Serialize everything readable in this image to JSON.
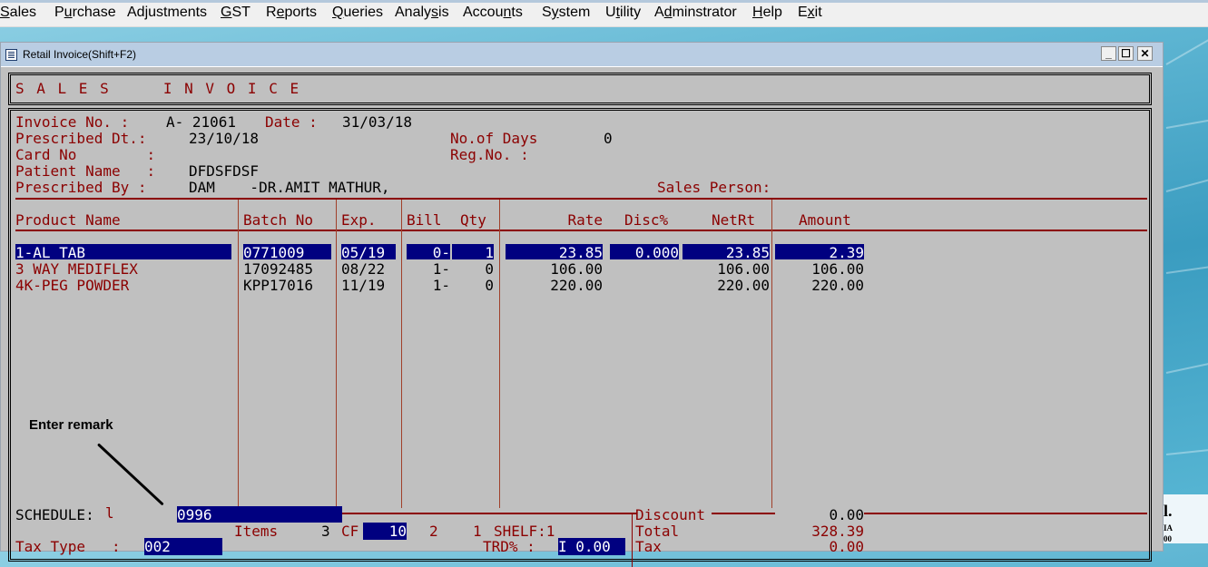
{
  "menubar": {
    "items": [
      {
        "label": "Sales",
        "mnemonic": "S"
      },
      {
        "label": "Purchase",
        "mnemonic": "u"
      },
      {
        "label": "Adjustments",
        "mnemonic": "j"
      },
      {
        "label": "GST",
        "mnemonic": "G"
      },
      {
        "label": "Reports",
        "mnemonic": "e"
      },
      {
        "label": "Queries",
        "mnemonic": "Q"
      },
      {
        "label": "Analysis",
        "mnemonic": "s"
      },
      {
        "label": "Accounts",
        "mnemonic": "n"
      },
      {
        "label": "System",
        "mnemonic": "y"
      },
      {
        "label": "Utility",
        "mnemonic": "t"
      },
      {
        "label": "Adminstrator",
        "mnemonic": "d"
      },
      {
        "label": "Help",
        "mnemonic": "H"
      },
      {
        "label": "Exit",
        "mnemonic": "x"
      }
    ]
  },
  "window": {
    "title": "Retail Invoice(Shift+F2)",
    "icon": "window-menu-icon",
    "controls": {
      "minimize": "_",
      "maximize": "☐",
      "close": "✕"
    }
  },
  "invoice": {
    "heading": "S A L E S     I N V O I C E",
    "invoice_no_label": "Invoice No. :",
    "invoice_no": "A- 21061",
    "date_label": "Date :",
    "date": "31/03/18",
    "prescribed_dt_label": "Prescribed Dt.:",
    "prescribed_dt": "23/10/18",
    "no_of_days_label": "No.of Days",
    "no_of_days": "0",
    "card_no_label": "Card No        :",
    "card_no": "",
    "reg_no_label": "Reg.No. :",
    "reg_no": "",
    "patient_name_label": "Patient Name   :",
    "patient_name": "DFDSFDSF",
    "prescribed_by_label": "Prescribed By :",
    "prescribed_by": "DAM    -DR.AMIT MATHUR,",
    "sales_person_label": "Sales Person:",
    "sales_person": ""
  },
  "table": {
    "columns": [
      "Product Name",
      "Batch No",
      "Exp.",
      "Bill",
      "Qty",
      "Rate",
      "Disc%",
      "NetRt",
      "Amount"
    ],
    "rows": [
      {
        "product": "1-AL TAB",
        "batch": "0771009",
        "exp": "05/19",
        "bill": "0-",
        "qty": "1",
        "rate": "23.85",
        "disc": "0.000",
        "netrt": "23.85",
        "amount": "2.39",
        "selected": true
      },
      {
        "product": "3 WAY MEDIFLEX",
        "batch": "17092485",
        "exp": "08/22",
        "bill": "1-",
        "qty": "0",
        "rate": "106.00",
        "disc": "",
        "netrt": "106.00",
        "amount": "106.00",
        "selected": false
      },
      {
        "product": "4K-PEG POWDER",
        "batch": "KPP17016",
        "exp": "11/19",
        "bill": "1-",
        "qty": "0",
        "rate": "220.00",
        "disc": "",
        "netrt": "220.00",
        "amount": "220.00",
        "selected": false
      }
    ]
  },
  "annotation": {
    "label": "Enter remark"
  },
  "footer": {
    "schedule_label": "SCHEDULE:",
    "schedule_value": "l",
    "remark_value": "0996",
    "items_label": "Items",
    "items_count": "3",
    "cf_label": "CF",
    "cf_value": "10",
    "num2": "2",
    "num1": "1",
    "shelf_label": "SHELF:1",
    "discount_label": "Discount",
    "discount_value": "0.00",
    "total_label": "Total",
    "total_value": "328.39",
    "tax_type_label": "Tax Type   :",
    "tax_type_value": "002",
    "trd_label": "TRD% :",
    "trd_value": "I 0.00",
    "tax_label": "Tax",
    "tax_value": "0.00"
  },
  "background_text": {
    "line1": "l.",
    "line2": "IA",
    "line3": "00"
  }
}
